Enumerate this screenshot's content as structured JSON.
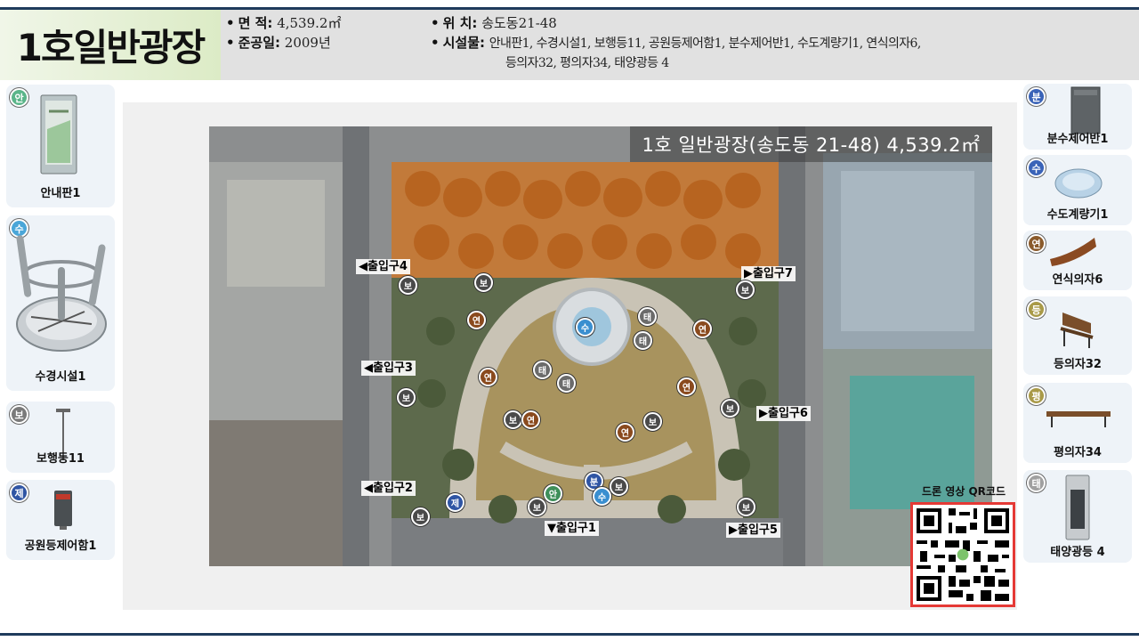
{
  "title": "1호일반광장",
  "info": {
    "area_label": "면    적:",
    "area_value": "4,539.2㎡",
    "date_label": "준공일:",
    "date_value": "2009년",
    "location_label": "위    치:",
    "location_value": "송도동21-48",
    "facilities_label": "시설물:",
    "facilities_line1": "안내판1, 수경시설1, 보행등11, 공원등제어함1, 분수제어반1, 수도계량기1, 연식의자6,",
    "facilities_line2": "등의자32, 평의자34, 태양광등 4"
  },
  "left_cards": [
    {
      "badge": "안",
      "label": "안내판1",
      "color": "#5bb58a"
    },
    {
      "badge": "수",
      "label": "수경시설1",
      "color": "#4aa6d8"
    },
    {
      "badge": "보",
      "label": "보행등11",
      "color": "#7a7a7a"
    },
    {
      "badge": "제",
      "label": "공원등제어함1",
      "color": "#2f55a4"
    }
  ],
  "right_cards": [
    {
      "badge": "분",
      "label": "분수제어반1",
      "color": "#3a63b8"
    },
    {
      "badge": "수",
      "label": "수도계량기1",
      "color": "#3a63b8"
    },
    {
      "badge": "연",
      "label": "연식의자6",
      "color": "#8a5a2b"
    },
    {
      "badge": "등",
      "label": "등의자32",
      "color": "#a99a48"
    },
    {
      "badge": "평",
      "label": "평의자34",
      "color": "#a99a48"
    },
    {
      "badge": "태",
      "label": "태양광등 4",
      "color": "#a0a0a0"
    }
  ],
  "map": {
    "caption": "1호 일반광장(송도동 21-48) 4,539.2㎡",
    "gates": [
      "◀출입구4",
      "◀출입구3",
      "◀출입구2",
      "▼출입구1",
      "▶출입구5",
      "▶출입구6",
      "▶출입구7"
    ],
    "markers": {
      "bo": "보",
      "yeon": "연",
      "tae": "태",
      "su": "수",
      "an": "안",
      "bun": "분",
      "je": "제"
    }
  },
  "qr_label": "드론 영상 QR코드",
  "colors": {
    "rule": "#1f3b5c",
    "qr_border": "#e53935",
    "marker_bo": "#4a4a4a",
    "marker_yeon": "#8a4a1e",
    "marker_tae": "#6b6b6b",
    "marker_su": "#3a8fd0",
    "marker_an": "#3f8f5a",
    "marker_bun": "#2f55a4",
    "marker_je": "#2f55a4"
  }
}
